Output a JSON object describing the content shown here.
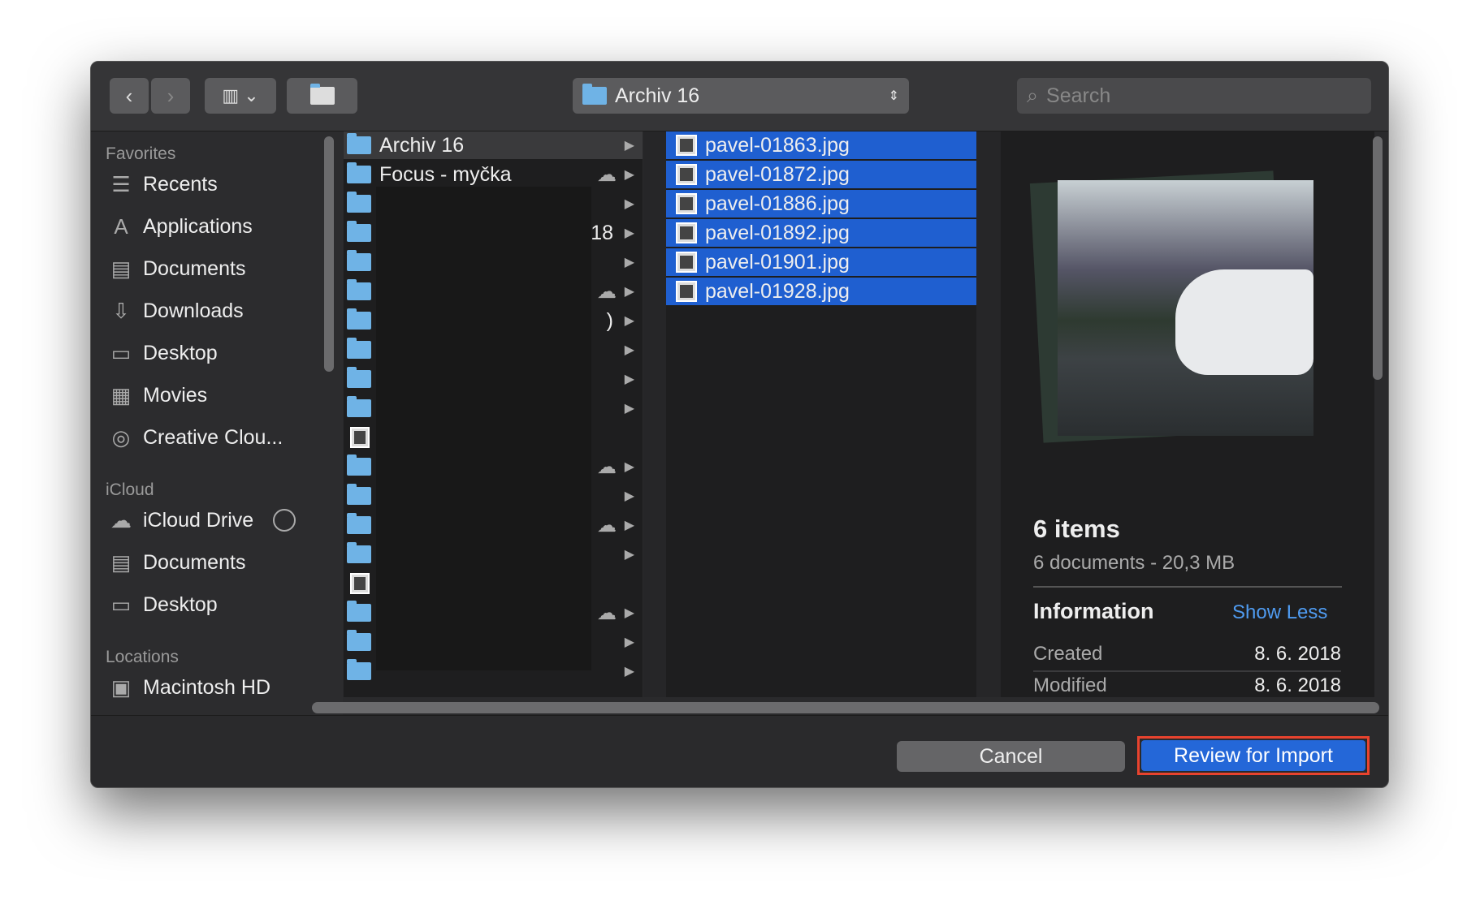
{
  "toolbar": {
    "back": "‹",
    "forward": "›",
    "view": "▥ ⌄",
    "new_folder": "new-folder",
    "path": "Archiv 16",
    "search_placeholder": "Search"
  },
  "sidebar": {
    "favorites_label": "Favorites",
    "favorites": [
      {
        "label": "Recents",
        "icon": "☰"
      },
      {
        "label": "Applications",
        "icon": "A"
      },
      {
        "label": "Documents",
        "icon": "▤"
      },
      {
        "label": "Downloads",
        "icon": "⇩"
      },
      {
        "label": "Desktop",
        "icon": "▭"
      },
      {
        "label": "Movies",
        "icon": "▦"
      },
      {
        "label": "Creative Clou...",
        "icon": "◎"
      }
    ],
    "icloud_label": "iCloud",
    "icloud": [
      {
        "label": "iCloud Drive",
        "icon": "☁"
      },
      {
        "label": "Documents",
        "icon": "▤"
      },
      {
        "label": "Desktop",
        "icon": "▭"
      }
    ],
    "locations_label": "Locations",
    "locations": [
      {
        "label": "Macintosh HD",
        "icon": "▣"
      }
    ]
  },
  "column1": [
    {
      "name": "Archiv 16",
      "type": "folder",
      "cloud": false
    },
    {
      "name": "Focus - myčka",
      "type": "folder",
      "cloud": true
    },
    {
      "name": "",
      "type": "folder",
      "cloud": false
    },
    {
      "name": "18",
      "type": "folder",
      "cloud": false
    },
    {
      "name": "",
      "type": "folder",
      "cloud": false
    },
    {
      "name": "",
      "type": "folder",
      "cloud": true
    },
    {
      "name": ")",
      "type": "folder",
      "cloud": false
    },
    {
      "name": "",
      "type": "folder",
      "cloud": false
    },
    {
      "name": "",
      "type": "folder",
      "cloud": false
    },
    {
      "name": "",
      "type": "folder",
      "cloud": false
    },
    {
      "name": "",
      "type": "image",
      "cloud": false
    },
    {
      "name": "",
      "type": "folder",
      "cloud": true
    },
    {
      "name": "",
      "type": "folder",
      "cloud": false
    },
    {
      "name": "",
      "type": "folder",
      "cloud": true
    },
    {
      "name": "",
      "type": "folder",
      "cloud": false
    },
    {
      "name": "",
      "type": "image",
      "cloud": false
    },
    {
      "name": "",
      "type": "folder",
      "cloud": true
    },
    {
      "name": "",
      "type": "folder",
      "cloud": false
    },
    {
      "name": "",
      "type": "folder",
      "cloud": false
    }
  ],
  "column2": [
    "pavel-01863.jpg",
    "pavel-01872.jpg",
    "pavel-01886.jpg",
    "pavel-01892.jpg",
    "pavel-01901.jpg",
    "pavel-01928.jpg"
  ],
  "preview": {
    "title": "6 items",
    "subtitle": "6 documents - 20,3 MB",
    "info_label": "Information",
    "show_less": "Show Less",
    "created_label": "Created",
    "created_value": "8. 6. 2018",
    "modified_label": "Modified",
    "modified_value": "8. 6. 2018"
  },
  "buttons": {
    "cancel": "Cancel",
    "primary": "Review for Import"
  },
  "colors": {
    "accent": "#2467d8",
    "highlight": "#e8432e"
  }
}
